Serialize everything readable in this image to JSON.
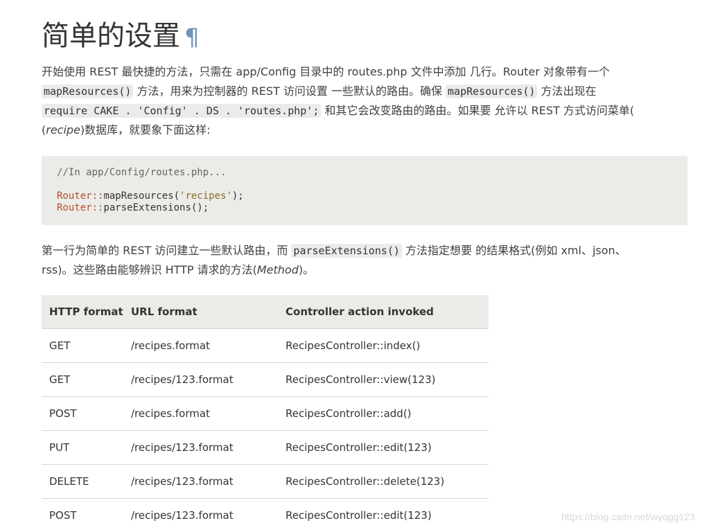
{
  "heading": {
    "title": "简单的设置",
    "anchor": "¶"
  },
  "para1": {
    "t1": "开始使用 REST 最快捷的方法，只需在 app/Config 目录中的 routes.php 文件中添加 几行。Router 对象带有一个",
    "c1": "mapResources()",
    "t2": " 方法，用来为控制器的 REST 访问设置 一些默认的路由。确保 ",
    "c2": "mapResources()",
    "t3": " 方法出现在",
    "c3": "require CAKE . 'Config' . DS . 'routes.php';",
    "t4": " 和其它会改变路由的路由。如果要 允许以 REST 方式访问菜单(",
    "em1": "recipe",
    "t5": ")数据库，就要象下面这样:"
  },
  "code": {
    "comment": "//In app/Config/routes.php...",
    "l1_cls": "Router",
    "l1_sep": "::",
    "l1_fn": "mapResources(",
    "l1_str": "'recipes'",
    "l1_end": ");",
    "l2_cls": "Router",
    "l2_sep": "::",
    "l2_fn": "parseExtensions();"
  },
  "para2": {
    "t1": "第一行为简单的 REST 访问建立一些默认路由，而 ",
    "c1": "parseExtensions()",
    "t2": " 方法指定想要 的结果格式(例如 xml、json、",
    "t3": "rss)。这些路由能够辨识 HTTP 请求的方法(",
    "em1": "Method",
    "t4": ")。"
  },
  "table": {
    "headers": [
      "HTTP format",
      "URL format",
      "Controller action invoked"
    ],
    "rows": [
      [
        "GET",
        "/recipes.format",
        "RecipesController::index()"
      ],
      [
        "GET",
        "/recipes/123.format",
        "RecipesController::view(123)"
      ],
      [
        "POST",
        "/recipes.format",
        "RecipesController::add()"
      ],
      [
        "PUT",
        "/recipes/123.format",
        "RecipesController::edit(123)"
      ],
      [
        "DELETE",
        "/recipes/123.format",
        "RecipesController::delete(123)"
      ],
      [
        "POST",
        "/recipes/123.format",
        "RecipesController::edit(123)"
      ]
    ]
  },
  "watermark": "https://blog.csdn.net/wyqgg123"
}
